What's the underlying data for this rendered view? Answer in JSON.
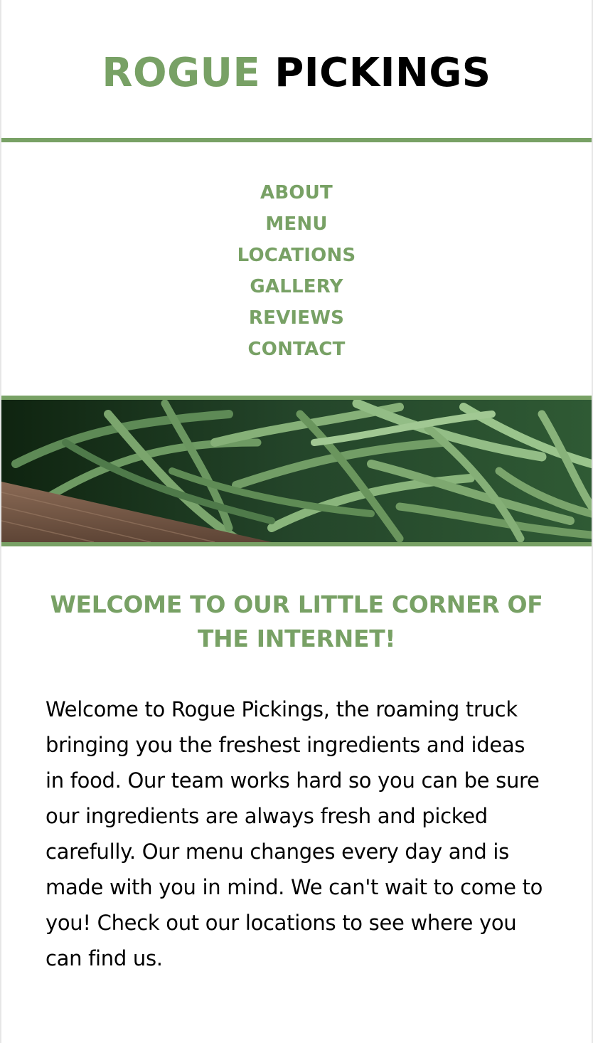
{
  "header": {
    "logo_word1": "ROGUE",
    "logo_word2": "PICKINGS"
  },
  "nav": {
    "items": [
      {
        "label": "ABOUT"
      },
      {
        "label": "MENU"
      },
      {
        "label": "LOCATIONS"
      },
      {
        "label": "GALLERY"
      },
      {
        "label": "REVIEWS"
      },
      {
        "label": "CONTACT"
      }
    ]
  },
  "hero": {
    "image": "green-beans-photo"
  },
  "main": {
    "title": "WELCOME TO OUR LITTLE CORNER OF THE INTERNET!",
    "body": "Welcome to Rogue Pickings, the roaming truck bringing you the freshest ingredients and ideas in food. Our team works hard so you can be sure our ingredients are always fresh and picked carefully. Our menu changes every day and is made with you in mind. We can't wait to come to you! Check out our locations to see where you can find us."
  },
  "colors": {
    "accent": "#78a165",
    "text": "#000000",
    "background": "#ffffff"
  }
}
